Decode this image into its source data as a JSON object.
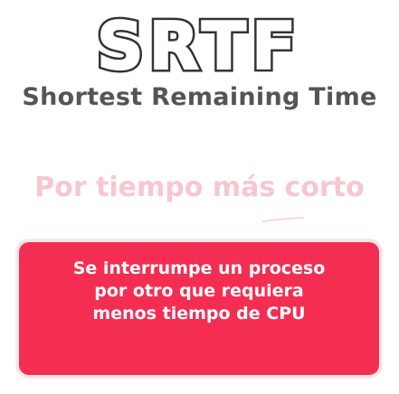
{
  "logo": {
    "text": "SRTF"
  },
  "subtitle": "Shortest Remaining Time",
  "tagline": "Por tiempo más corto",
  "card": {
    "lines": [
      "Se interrumpe un proceso",
      "por otro que requiera",
      "menos tiempo de CPU"
    ]
  },
  "colors": {
    "accent": "#f42e52",
    "logo_stroke": "#333333",
    "subtitle": "#555555",
    "tagline": "#f7c7d0",
    "card_text": "#ffffff"
  }
}
